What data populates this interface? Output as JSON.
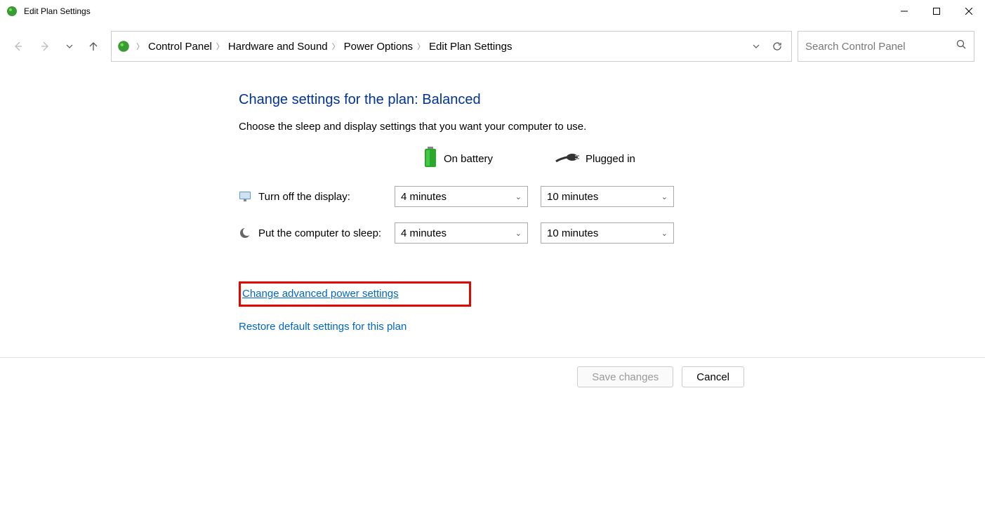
{
  "window": {
    "title": "Edit Plan Settings"
  },
  "breadcrumb": {
    "items": [
      "Control Panel",
      "Hardware and Sound",
      "Power Options",
      "Edit Plan Settings"
    ]
  },
  "search": {
    "placeholder": "Search Control Panel"
  },
  "main": {
    "heading": "Change settings for the plan: Balanced",
    "subtext": "Choose the sleep and display settings that you want your computer to use.",
    "columns": {
      "battery": "On battery",
      "plugged": "Plugged in"
    },
    "rows": {
      "display": {
        "label": "Turn off the display:",
        "battery_value": "4 minutes",
        "plugged_value": "10 minutes"
      },
      "sleep": {
        "label": "Put the computer to sleep:",
        "battery_value": "4 minutes",
        "plugged_value": "10 minutes"
      }
    },
    "links": {
      "advanced": "Change advanced power settings",
      "restore": "Restore default settings for this plan"
    },
    "buttons": {
      "save": "Save changes",
      "cancel": "Cancel"
    }
  }
}
